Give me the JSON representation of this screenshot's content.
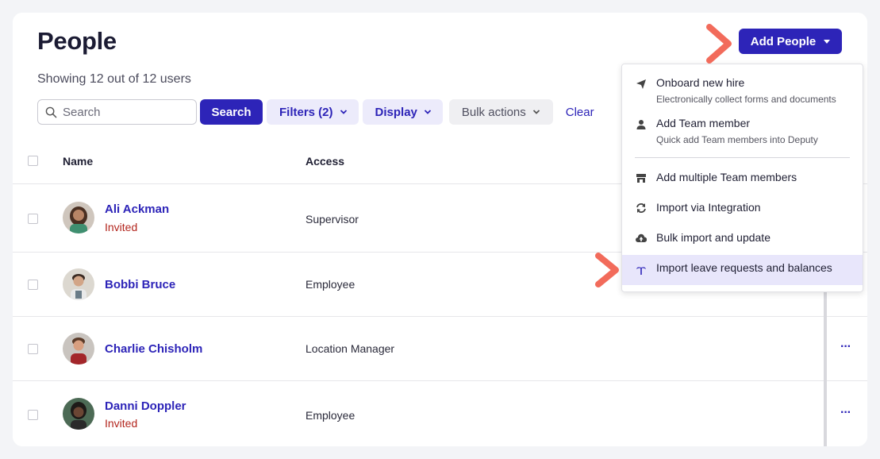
{
  "page": {
    "title": "People",
    "subtitle": "Showing 12 out of 12 users"
  },
  "toolbar": {
    "search_placeholder": "Search",
    "search_button": "Search",
    "filters": "Filters (2)",
    "display": "Display",
    "bulk_actions": "Bulk actions",
    "clear": "Clear"
  },
  "header": {
    "add_people": "Add People"
  },
  "table": {
    "columns": [
      "Name",
      "Access"
    ],
    "rows": [
      {
        "name": "Ali Ackman",
        "status": "Invited",
        "access": "Supervisor"
      },
      {
        "name": "Bobbi Bruce",
        "status": "",
        "access": "Employee"
      },
      {
        "name": "Charlie Chisholm",
        "status": "",
        "access": "Location Manager"
      },
      {
        "name": "Danni Doppler",
        "status": "Invited",
        "access": "Employee"
      }
    ],
    "row_actions": "···"
  },
  "menu": {
    "items": [
      {
        "label": "Onboard new hire",
        "desc": "Electronically collect forms and documents",
        "icon": "paper-plane-icon"
      },
      {
        "label": "Add Team member",
        "desc": "Quick add Team members into Deputy",
        "icon": "person-icon"
      },
      {
        "label": "Add multiple Team members",
        "desc": "",
        "icon": "store-icon"
      },
      {
        "label": "Import via Integration",
        "desc": "",
        "icon": "sync-icon"
      },
      {
        "label": "Bulk import and update",
        "desc": "",
        "icon": "cloud-upload-icon"
      },
      {
        "label": "Import leave requests and balances",
        "desc": "",
        "icon": "palm-tree-icon"
      }
    ],
    "highlighted_index": 5
  },
  "colors": {
    "accent": "#2d24b8",
    "invited": "#b3261e",
    "arrow": "#f26b5b",
    "highlight": "#e8e6fb"
  }
}
